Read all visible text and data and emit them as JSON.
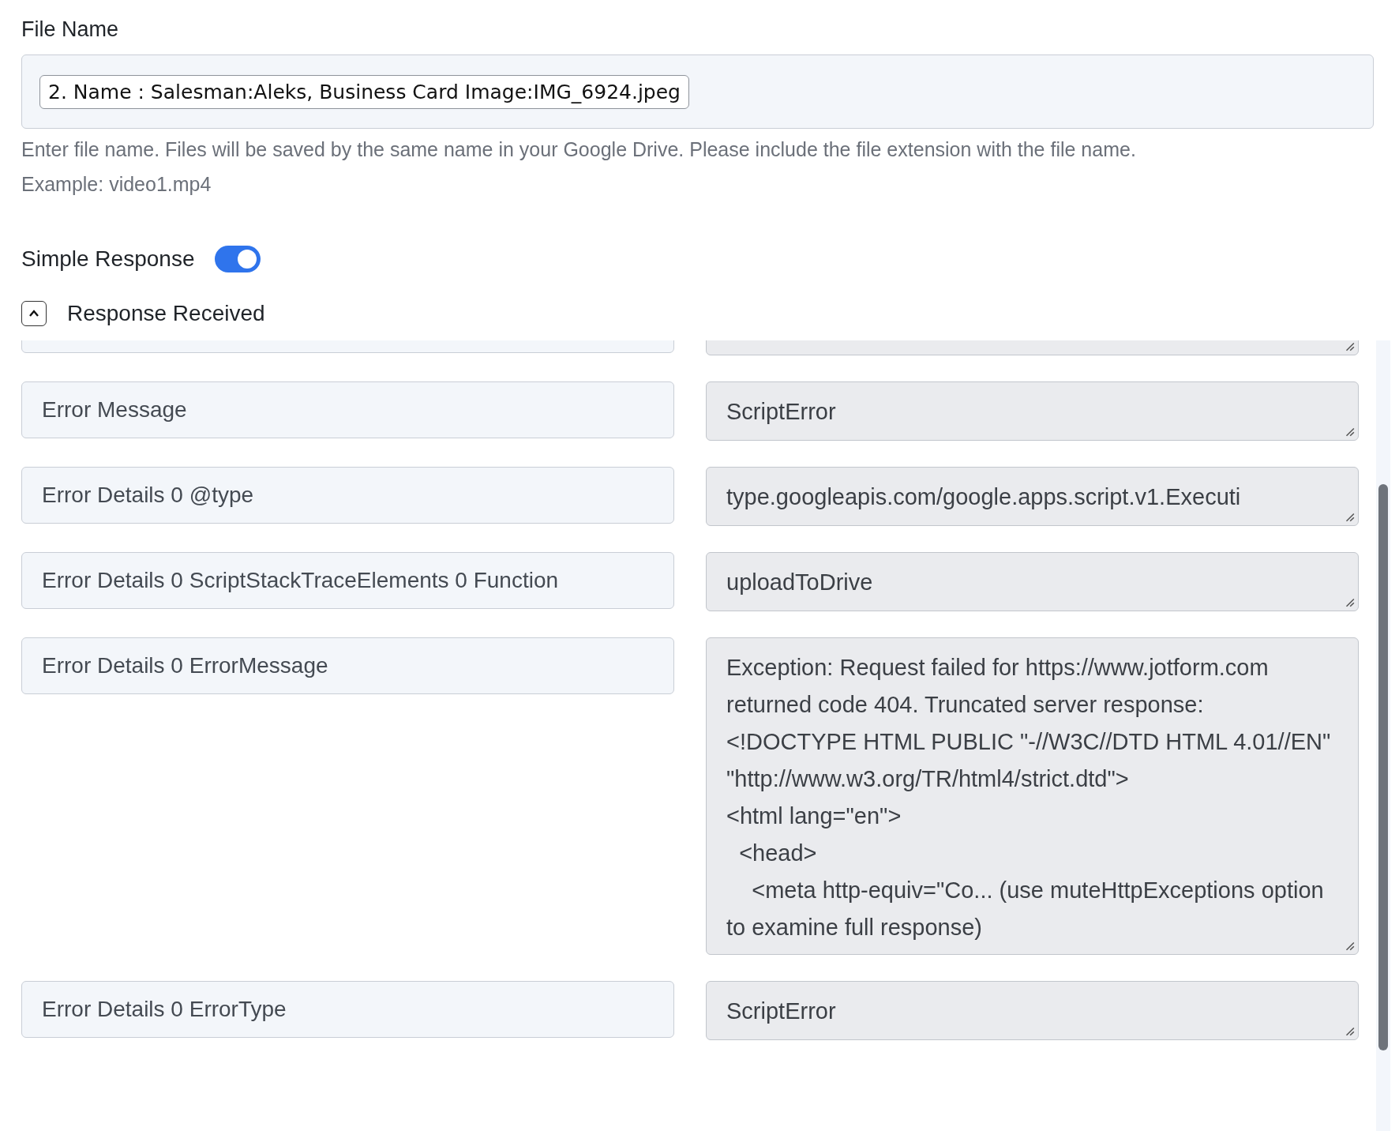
{
  "file_name": {
    "label": "File Name",
    "value": "2. Name : Salesman:Aleks, Business Card Image:IMG_6924.jpeg",
    "help": [
      "Enter file name. Files will be saved by the same name in your Google Drive. Please include the file extension with the file name.",
      "Example: video1.mp4"
    ]
  },
  "simple_response": {
    "label": "Simple Response",
    "on": true
  },
  "response_received": {
    "label": "Response Received",
    "expanded": true,
    "rows": [
      {
        "key": "Error Message",
        "value": "ScriptError"
      },
      {
        "key": "Error Details 0 @type",
        "value": "type.googleapis.com/google.apps.script.v1.Executi"
      },
      {
        "key": "Error Details 0 ScriptStackTraceElements 0 Function",
        "value": "uploadToDrive"
      },
      {
        "key": "Error Details 0 ErrorMessage",
        "value": "Exception: Request failed for https://www.jotform.com returned code 404. Truncated server response: <!DOCTYPE HTML PUBLIC \"-//W3C//DTD HTML 4.01//EN\" \"http://www.w3.org/TR/html4/strict.dtd\">\n<html lang=\"en\">\n  <head>\n    <meta http-equiv=\"Co... (use muteHttpExceptions option to examine full response)"
      },
      {
        "key": "Error Details 0 ErrorType",
        "value": "ScriptError"
      }
    ]
  }
}
